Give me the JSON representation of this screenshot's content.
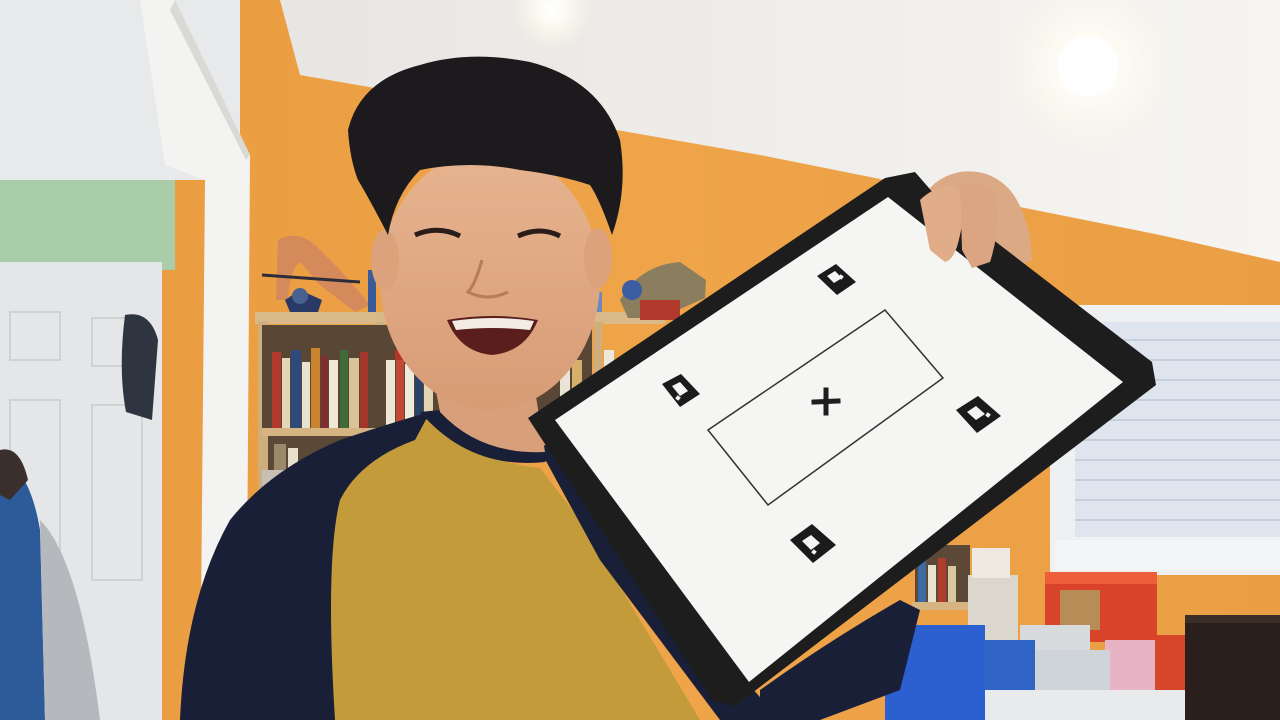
{
  "scene": {
    "description_tag": "webcam-photo",
    "wall_color": "#eda047",
    "ceiling_color": "#f2f0ec",
    "door_color": "#e6e8ea",
    "hallway_wall_color": "#a9cfa9",
    "shirt_body_color": "#c19a3a",
    "shirt_sleeve_color": "#1a1f36",
    "board_color": "#1c1c1c",
    "paper_color": "#f4f4f2"
  },
  "sheet": {
    "markers": [
      "aruco-marker-top",
      "aruco-marker-left",
      "aruco-marker-right",
      "aruco-marker-bottom"
    ],
    "center_symbol": "+"
  }
}
